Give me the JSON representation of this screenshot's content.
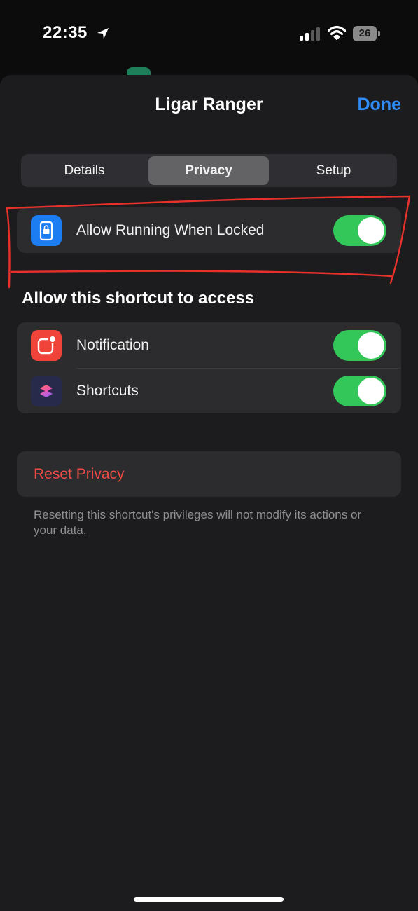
{
  "status_bar": {
    "time": "22:35",
    "battery": "26",
    "icons": [
      "location-arrow-icon",
      "cellular-signal-icon",
      "wifi-icon",
      "battery-icon"
    ]
  },
  "header": {
    "title": "Ligar Ranger",
    "done_label": "Done"
  },
  "tabs": [
    {
      "label": "Details",
      "selected": false
    },
    {
      "label": "Privacy",
      "selected": true
    },
    {
      "label": "Setup",
      "selected": false
    }
  ],
  "lock_setting": {
    "label": "Allow Running When Locked",
    "icon": "lock-screen-icon",
    "enabled": true
  },
  "access_section": {
    "header": "Allow this shortcut to access",
    "items": [
      {
        "label": "Notification",
        "icon": "notification-icon",
        "enabled": true
      },
      {
        "label": "Shortcuts",
        "icon": "shortcuts-app-icon",
        "enabled": true
      }
    ]
  },
  "reset": {
    "label": "Reset Privacy",
    "footnote": "Resetting this shortcut's privileges will not modify its actions or your data."
  },
  "colors": {
    "accent": "#2f8cf7",
    "toggle_on": "#33c759",
    "destructive": "#f04a45",
    "annotation": "#e8312b"
  }
}
